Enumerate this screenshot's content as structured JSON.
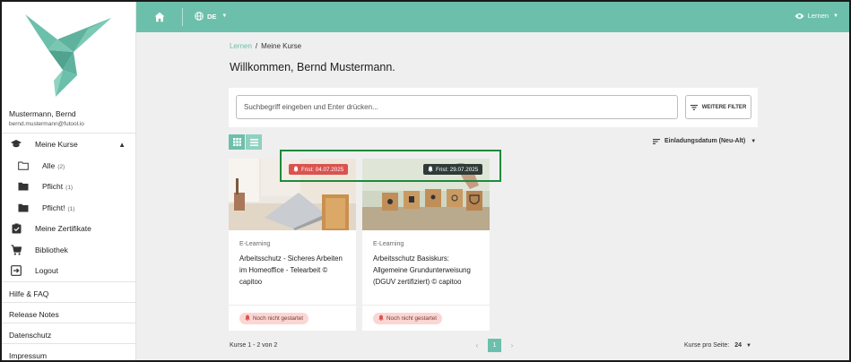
{
  "colors": {
    "accent": "#6cc0ab",
    "deadline_red": "#d9534f",
    "deadline_dark": "#2e3b36",
    "highlight_green": "#1e8a3a"
  },
  "user": {
    "name": "Mustermann, Bernd",
    "email": "bernd.mustermann@futool.io"
  },
  "sidebar": {
    "my_courses": "Meine Kurse",
    "folders": [
      {
        "label": "Alle",
        "count": "(2)",
        "icon": "folder-outline-icon"
      },
      {
        "label": "Pflicht",
        "count": "(1)",
        "icon": "folder-filled-icon"
      },
      {
        "label": "Pflicht!",
        "count": "(1)",
        "icon": "folder-filled-icon"
      }
    ],
    "certificates": "Meine Zertifikate",
    "library": "Bibliothek",
    "logout": "Logout",
    "links": [
      "Hilfe & FAQ",
      "Release Notes",
      "Datenschutz",
      "Impressum"
    ]
  },
  "topbar": {
    "language": "DE",
    "mode": "Lernen"
  },
  "breadcrumb": {
    "root": "Lernen",
    "separator": "/",
    "current": "Meine Kurse"
  },
  "page_title": "Willkommen, Bernd Mustermann.",
  "search": {
    "placeholder": "Suchbegriff eingeben und Enter drücken...",
    "filter_label": "WEITERE FILTER"
  },
  "sort": {
    "label": "Einladungsdatum (Neu-Alt)"
  },
  "courses": [
    {
      "type": "E-Learning",
      "title": "Arbeitsschutz - Sicheres Arbeiten im Homeoffice - Telearbeit © capitoo",
      "deadline": "Frist: 04.07.2025",
      "status": "Noch nicht gestartet"
    },
    {
      "type": "E-Learning",
      "title": "Arbeitsschutz Basiskurs: Allgemeine Grundunterweisung (DGUV zertifiziert) © capitoo",
      "deadline": "Frist: 29.07.2025",
      "status": "Noch nicht gestartet"
    }
  ],
  "footer": {
    "count": "Kurse 1 - 2 von 2",
    "page": "1",
    "per_page_label": "Kurse pro Seite:",
    "per_page_value": "24"
  }
}
